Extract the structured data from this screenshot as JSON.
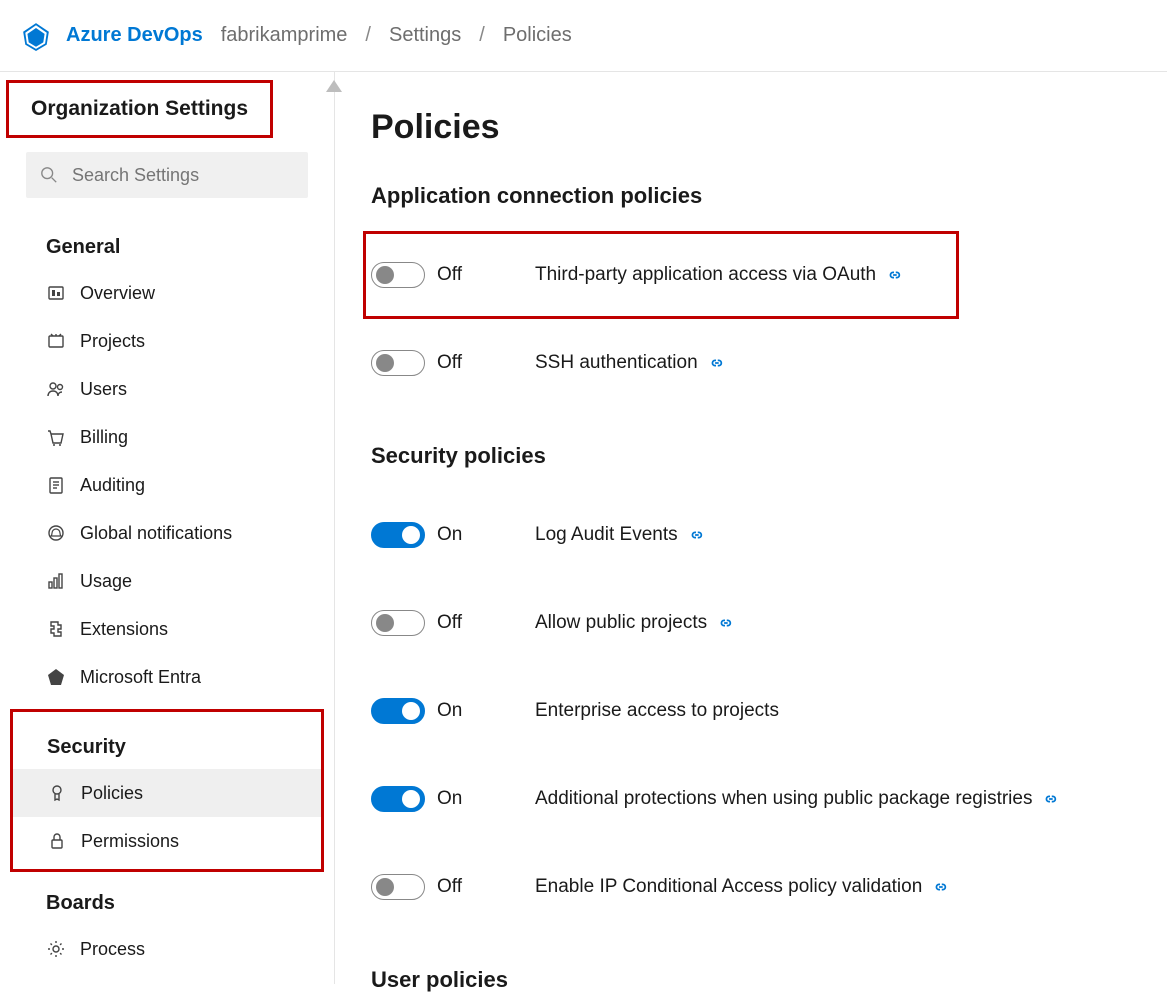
{
  "header": {
    "brand": "Azure DevOps",
    "crumbs": [
      "fabrikamprime",
      "Settings",
      "Policies"
    ]
  },
  "sidebar": {
    "title": "Organization Settings",
    "search_placeholder": "Search Settings",
    "sections": {
      "general": {
        "label": "General",
        "items": [
          {
            "icon": "overview",
            "label": "Overview"
          },
          {
            "icon": "projects",
            "label": "Projects"
          },
          {
            "icon": "users",
            "label": "Users"
          },
          {
            "icon": "billing",
            "label": "Billing"
          },
          {
            "icon": "auditing",
            "label": "Auditing"
          },
          {
            "icon": "notifications",
            "label": "Global notifications"
          },
          {
            "icon": "usage",
            "label": "Usage"
          },
          {
            "icon": "extensions",
            "label": "Extensions"
          },
          {
            "icon": "entra",
            "label": "Microsoft Entra"
          }
        ]
      },
      "security": {
        "label": "Security",
        "items": [
          {
            "icon": "policies",
            "label": "Policies",
            "active": true
          },
          {
            "icon": "permissions",
            "label": "Permissions"
          }
        ]
      },
      "boards": {
        "label": "Boards",
        "items": [
          {
            "icon": "process",
            "label": "Process"
          }
        ]
      }
    }
  },
  "main": {
    "title": "Policies",
    "sections": [
      {
        "title": "Application connection policies",
        "rows": [
          {
            "on": false,
            "state": "Off",
            "name": "Third-party application access via OAuth",
            "link": true,
            "emph": true
          },
          {
            "on": false,
            "state": "Off",
            "name": "SSH authentication",
            "link": true
          }
        ]
      },
      {
        "title": "Security policies",
        "rows": [
          {
            "on": true,
            "state": "On",
            "name": "Log Audit Events",
            "link": true
          },
          {
            "on": false,
            "state": "Off",
            "name": "Allow public projects",
            "link": true
          },
          {
            "on": true,
            "state": "On",
            "name": "Enterprise access to projects",
            "link": false
          },
          {
            "on": true,
            "state": "On",
            "name": "Additional protections when using public package registries",
            "link": true
          },
          {
            "on": false,
            "state": "Off",
            "name": "Enable IP Conditional Access policy validation",
            "link": true
          }
        ]
      },
      {
        "title": "User policies",
        "rows": []
      }
    ]
  }
}
